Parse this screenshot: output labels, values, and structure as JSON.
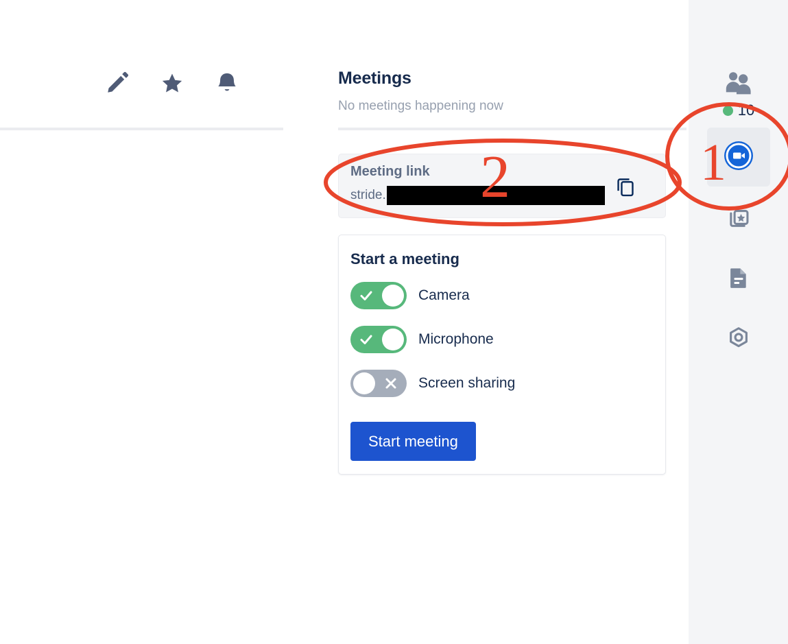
{
  "app": {
    "accent_blue": "#1d54cf",
    "toggle_on_green": "#57b87b",
    "toggle_off_gray": "#a5adba",
    "annotation_red": "#e8452c",
    "sidebar_bg": "#f4f5f7",
    "text_primary": "#172b4d",
    "text_muted": "#97a0af"
  },
  "toolbar": {
    "icons": [
      {
        "name": "edit-pencil-icon",
        "label": "Edit"
      },
      {
        "name": "star-icon",
        "label": "Favorite"
      },
      {
        "name": "bell-icon",
        "label": "Notifications"
      }
    ]
  },
  "main": {
    "title": "Meetings",
    "subtitle": "No meetings happening now",
    "link_card": {
      "label": "Meeting link",
      "url_prefix": "stride.",
      "url_redacted": true,
      "copy_label": "Copy meeting link"
    },
    "start_card": {
      "title": "Start a meeting",
      "toggles": [
        {
          "label": "Camera",
          "state": "on",
          "mark": "check"
        },
        {
          "label": "Microphone",
          "state": "on",
          "mark": "check"
        },
        {
          "label": "Screen sharing",
          "state": "off",
          "mark": "cross"
        }
      ],
      "start_button_label": "Start meeting"
    }
  },
  "sidebar": {
    "items": [
      {
        "name": "people",
        "icon": "people-icon",
        "label": "People",
        "count": "10",
        "status": "online",
        "active": false
      },
      {
        "name": "meeting",
        "icon": "video-camera-icon",
        "label": "Meetings",
        "active": true
      },
      {
        "name": "apps",
        "icon": "apps-cards-icon",
        "label": "Apps",
        "active": false
      },
      {
        "name": "docs",
        "icon": "document-icon",
        "label": "Files",
        "active": false
      },
      {
        "name": "settings",
        "icon": "settings-hexagon-icon",
        "label": "Settings",
        "active": false
      }
    ]
  },
  "annotations": {
    "one": "1",
    "two": "2"
  }
}
